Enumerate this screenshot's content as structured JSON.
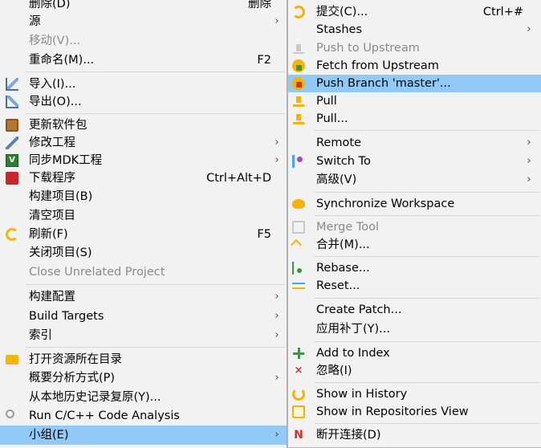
{
  "left_menu": {
    "items": [
      {
        "label": "删除(D)",
        "shortcut": "删除"
      },
      {
        "label": "源",
        "submenu": true
      },
      {
        "label": "移动(V)..."
      },
      {
        "label": "重命名(M)...",
        "shortcut": "F2"
      },
      {
        "label": "导入(I)...",
        "icon": "import-icon"
      },
      {
        "label": "导出(O)...",
        "icon": "export-icon"
      },
      {
        "label": "更新软件包",
        "icon": "package-icon"
      },
      {
        "label": "修改工程",
        "icon": "wrench-icon",
        "submenu": true
      },
      {
        "label": "同步MDK工程",
        "icon": "mdk-icon",
        "submenu": true
      },
      {
        "label": "下载程序",
        "icon": "download-icon",
        "shortcut": "Ctrl+Alt+D"
      },
      {
        "label": "构建项目(B)"
      },
      {
        "label": "清空项目"
      },
      {
        "label": "刷新(F)",
        "icon": "refresh-icon",
        "shortcut": "F5"
      },
      {
        "label": "关闭项目(S)"
      },
      {
        "label": "Close Unrelated Project"
      },
      {
        "label": "构建配置",
        "submenu": true
      },
      {
        "label": "Build Targets",
        "submenu": true
      },
      {
        "label": "索引",
        "submenu": true
      },
      {
        "label": "打开资源所在目录",
        "icon": "folder-icon"
      },
      {
        "label": "概要分析方式(P)",
        "submenu": true
      },
      {
        "label": "从本地历史记录复原(Y)..."
      },
      {
        "label": "Run C/C++ Code Analysis",
        "icon": "code-analysis-icon"
      },
      {
        "label": "小组(E)",
        "submenu": true
      }
    ]
  },
  "right_menu": {
    "items": [
      {
        "label": "提交(C)...",
        "shortcut": "Ctrl+#",
        "icon": "commit-icon"
      },
      {
        "label": "Stashes",
        "submenu": true
      },
      {
        "label": "Push to Upstream",
        "icon": "push-upstream-icon"
      },
      {
        "label": "Fetch from Upstream",
        "icon": "fetch-icon"
      },
      {
        "label": "Push Branch 'master'...",
        "icon": "push-branch-icon"
      },
      {
        "label": "Pull",
        "icon": "pull-icon"
      },
      {
        "label": "Pull...",
        "icon": "pull-dialog-icon"
      },
      {
        "label": "Remote",
        "submenu": true
      },
      {
        "label": "Switch To",
        "icon": "switch-branch-icon",
        "submenu": true
      },
      {
        "label": "高级(V)",
        "submenu": true
      },
      {
        "label": "Synchronize Workspace",
        "icon": "synchronize-icon"
      },
      {
        "label": "Merge Tool",
        "icon": "merge-tool-icon"
      },
      {
        "label": "合并(M)...",
        "icon": "merge-icon"
      },
      {
        "label": "Rebase...",
        "icon": "rebase-icon"
      },
      {
        "label": "Reset...",
        "icon": "reset-icon"
      },
      {
        "label": "Create Patch..."
      },
      {
        "label": "应用补丁(Y)..."
      },
      {
        "label": "Add to Index",
        "icon": "add-icon"
      },
      {
        "label": "忽略(I)",
        "icon": "ignore-icon",
        "glyph": "×"
      },
      {
        "label": "Show in History",
        "icon": "history-icon"
      },
      {
        "label": "Show in Repositories View",
        "icon": "repositories-view-icon"
      },
      {
        "label": "断开连接(D)",
        "icon": "disconnect-icon",
        "glyph": "N"
      }
    ]
  },
  "submenu_arrow": "›",
  "colors": {
    "highlight": "#91c9f7",
    "disabled_text": "#8a8a8a",
    "menu_background": "#f2f2f2"
  }
}
